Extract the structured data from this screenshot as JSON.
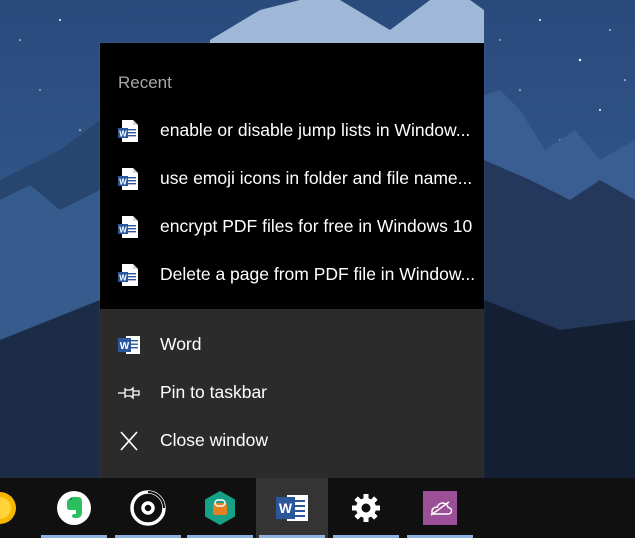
{
  "jumplist": {
    "recent_header": "Recent",
    "recent_items": [
      {
        "label": "enable or disable jump lists in Window...",
        "icon": "word-document-icon"
      },
      {
        "label": "use emoji icons in folder and file name...",
        "icon": "word-document-icon"
      },
      {
        "label": "encrypt PDF files for free in Windows 10",
        "icon": "word-document-icon"
      },
      {
        "label": "Delete a page from PDF file in Window...",
        "icon": "word-document-icon"
      }
    ],
    "actions": {
      "app_label": "Word",
      "pin_label": "Pin to taskbar",
      "close_label": "Close window"
    }
  },
  "taskbar": {
    "apps": [
      {
        "name": "partial-app",
        "icon": "yellow-circle-icon"
      },
      {
        "name": "evernote",
        "icon": "evernote-icon"
      },
      {
        "name": "groove",
        "icon": "groove-music-icon"
      },
      {
        "name": "app-store",
        "icon": "green-hexagon-icon"
      },
      {
        "name": "word",
        "icon": "word-icon",
        "active": true
      },
      {
        "name": "settings",
        "icon": "gear-icon"
      },
      {
        "name": "onenote",
        "icon": "cloud-icon"
      }
    ]
  },
  "colors": {
    "jumplist_top_bg": "#000000",
    "jumplist_bottom_bg": "#2b2b2b",
    "taskbar_bg": "#101010",
    "indicator": "#8fb3e0",
    "word_blue": "#2b579a",
    "evernote_green": "#2dbe60"
  }
}
